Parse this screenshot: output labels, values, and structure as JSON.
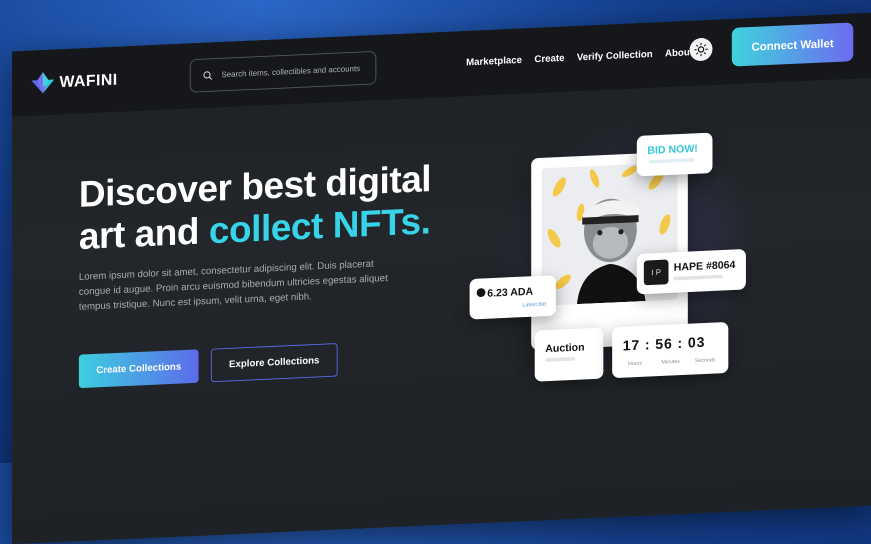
{
  "brand": {
    "name": "WAFINI"
  },
  "search": {
    "placeholder": "Search items, collectibles and accounts"
  },
  "nav": {
    "items": [
      {
        "label": "Marketplace"
      },
      {
        "label": "Create"
      },
      {
        "label": "Verify Collection"
      },
      {
        "label": "About"
      }
    ],
    "connect_label": "Connect Wallet"
  },
  "hero": {
    "title_line1": "Discover best digital",
    "title_line2_plain": "art and ",
    "title_line2_accent": "collect NFTs.",
    "body": "Lorem ipsum dolor sit amet, consectetur adipiscing elit. Duis placerat congue id augue. Proin arcu euismod bibendum ultricies egestas aliquet tempus tristique. Nunc est ipsum, velit urna, eget nibh.",
    "primary_button": "Create Collections",
    "secondary_button": "Explore Collections"
  },
  "card": {
    "bid_label": "BID NOW!",
    "price": "6.23 ADA",
    "price_sub": "Latest Bid",
    "nft_name": "HAPE #8064",
    "auction_label": "Auction",
    "timer": "17 : 56 : 03",
    "timer_labels": [
      "Hours",
      "Minutes",
      "Seconds"
    ]
  },
  "icons": [
    "logo-icon",
    "search-icon",
    "sun-icon",
    "ada-icon"
  ],
  "colors": {
    "accent": "#37d3e8",
    "gradient_start": "#3fd3dd",
    "gradient_end": "#6c6bf0",
    "bg": "#1d2023"
  }
}
